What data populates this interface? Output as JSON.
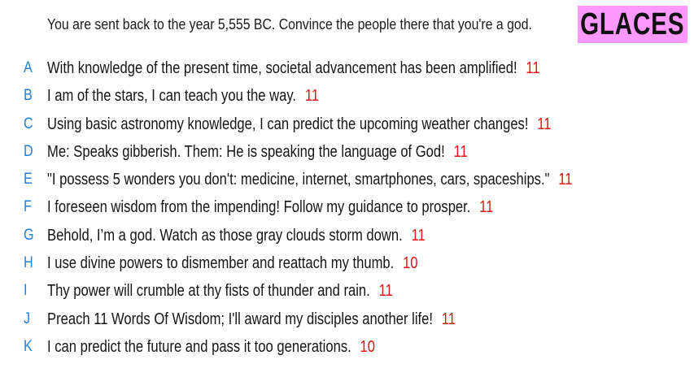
{
  "prompt": "You are sent back to the year 5,555 BC. Convince the people there that you're a god.",
  "badge": {
    "label": "GLACES",
    "color": "#ff99ff"
  },
  "colors": {
    "letter": "#1e7fd9",
    "score": "#e01515",
    "text": "#141414"
  },
  "answers": [
    {
      "letter": "A",
      "text": "With knowledge of the present time, societal advancement has been amplified!",
      "score": "11"
    },
    {
      "letter": "B",
      "text": "I am of the stars, I can teach you the way.",
      "score": "11"
    },
    {
      "letter": "C",
      "text": "Using basic astronomy knowledge, I can predict the upcoming weather changes!",
      "score": "11"
    },
    {
      "letter": "D",
      "text": "Me: Speaks gibberish. Them: He is speaking the language of God!",
      "score": "11"
    },
    {
      "letter": "E",
      "text": "\"I possess 5 wonders you don't: medicine, internet, smartphones, cars, spaceships.\"",
      "score": "11"
    },
    {
      "letter": "F",
      "text": "I foreseen wisdom from the impending! Follow my guidance to prosper.",
      "score": "11"
    },
    {
      "letter": "G",
      "text": "Behold, I’m a god. Watch as those gray clouds storm down.",
      "score": "11"
    },
    {
      "letter": "H",
      "text": "I use divine powers to dismember and reattach my thumb.",
      "score": "10"
    },
    {
      "letter": "I",
      "text": "Thy power will crumble at thy fists of thunder and rain.",
      "score": "11"
    },
    {
      "letter": "J",
      "text": "Preach 11 Words Of Wisdom; I'll award my disciples another life!",
      "score": "11"
    },
    {
      "letter": "K",
      "text": "I can predict the future and pass it too generations.",
      "score": "10"
    }
  ]
}
